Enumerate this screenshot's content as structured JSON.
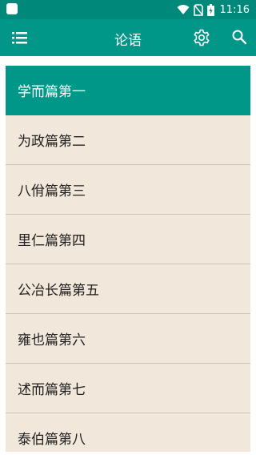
{
  "status_bar": {
    "time": "11:16",
    "icons": [
      "notification-icon",
      "wifi-icon",
      "no-sim-icon",
      "battery-icon"
    ]
  },
  "app_bar": {
    "title": "论语",
    "icons": [
      "menu-icon",
      "settings-gear-icon",
      "search-icon"
    ]
  },
  "chapters": [
    {
      "label": "学而篇第一",
      "selected": true
    },
    {
      "label": "为政篇第二",
      "selected": false
    },
    {
      "label": "八佾篇第三",
      "selected": false
    },
    {
      "label": "里仁篇第四",
      "selected": false
    },
    {
      "label": "公冶长篇第五",
      "selected": false
    },
    {
      "label": "雍也篇第六",
      "selected": false
    },
    {
      "label": "述而篇第七",
      "selected": false
    },
    {
      "label": "泰伯篇第八",
      "selected": false
    }
  ],
  "colors": {
    "primary": "#009688",
    "status_bar": "#00897b",
    "item_background": "#f1e7da",
    "selected_text": "#ffffff",
    "item_text": "#212121"
  }
}
